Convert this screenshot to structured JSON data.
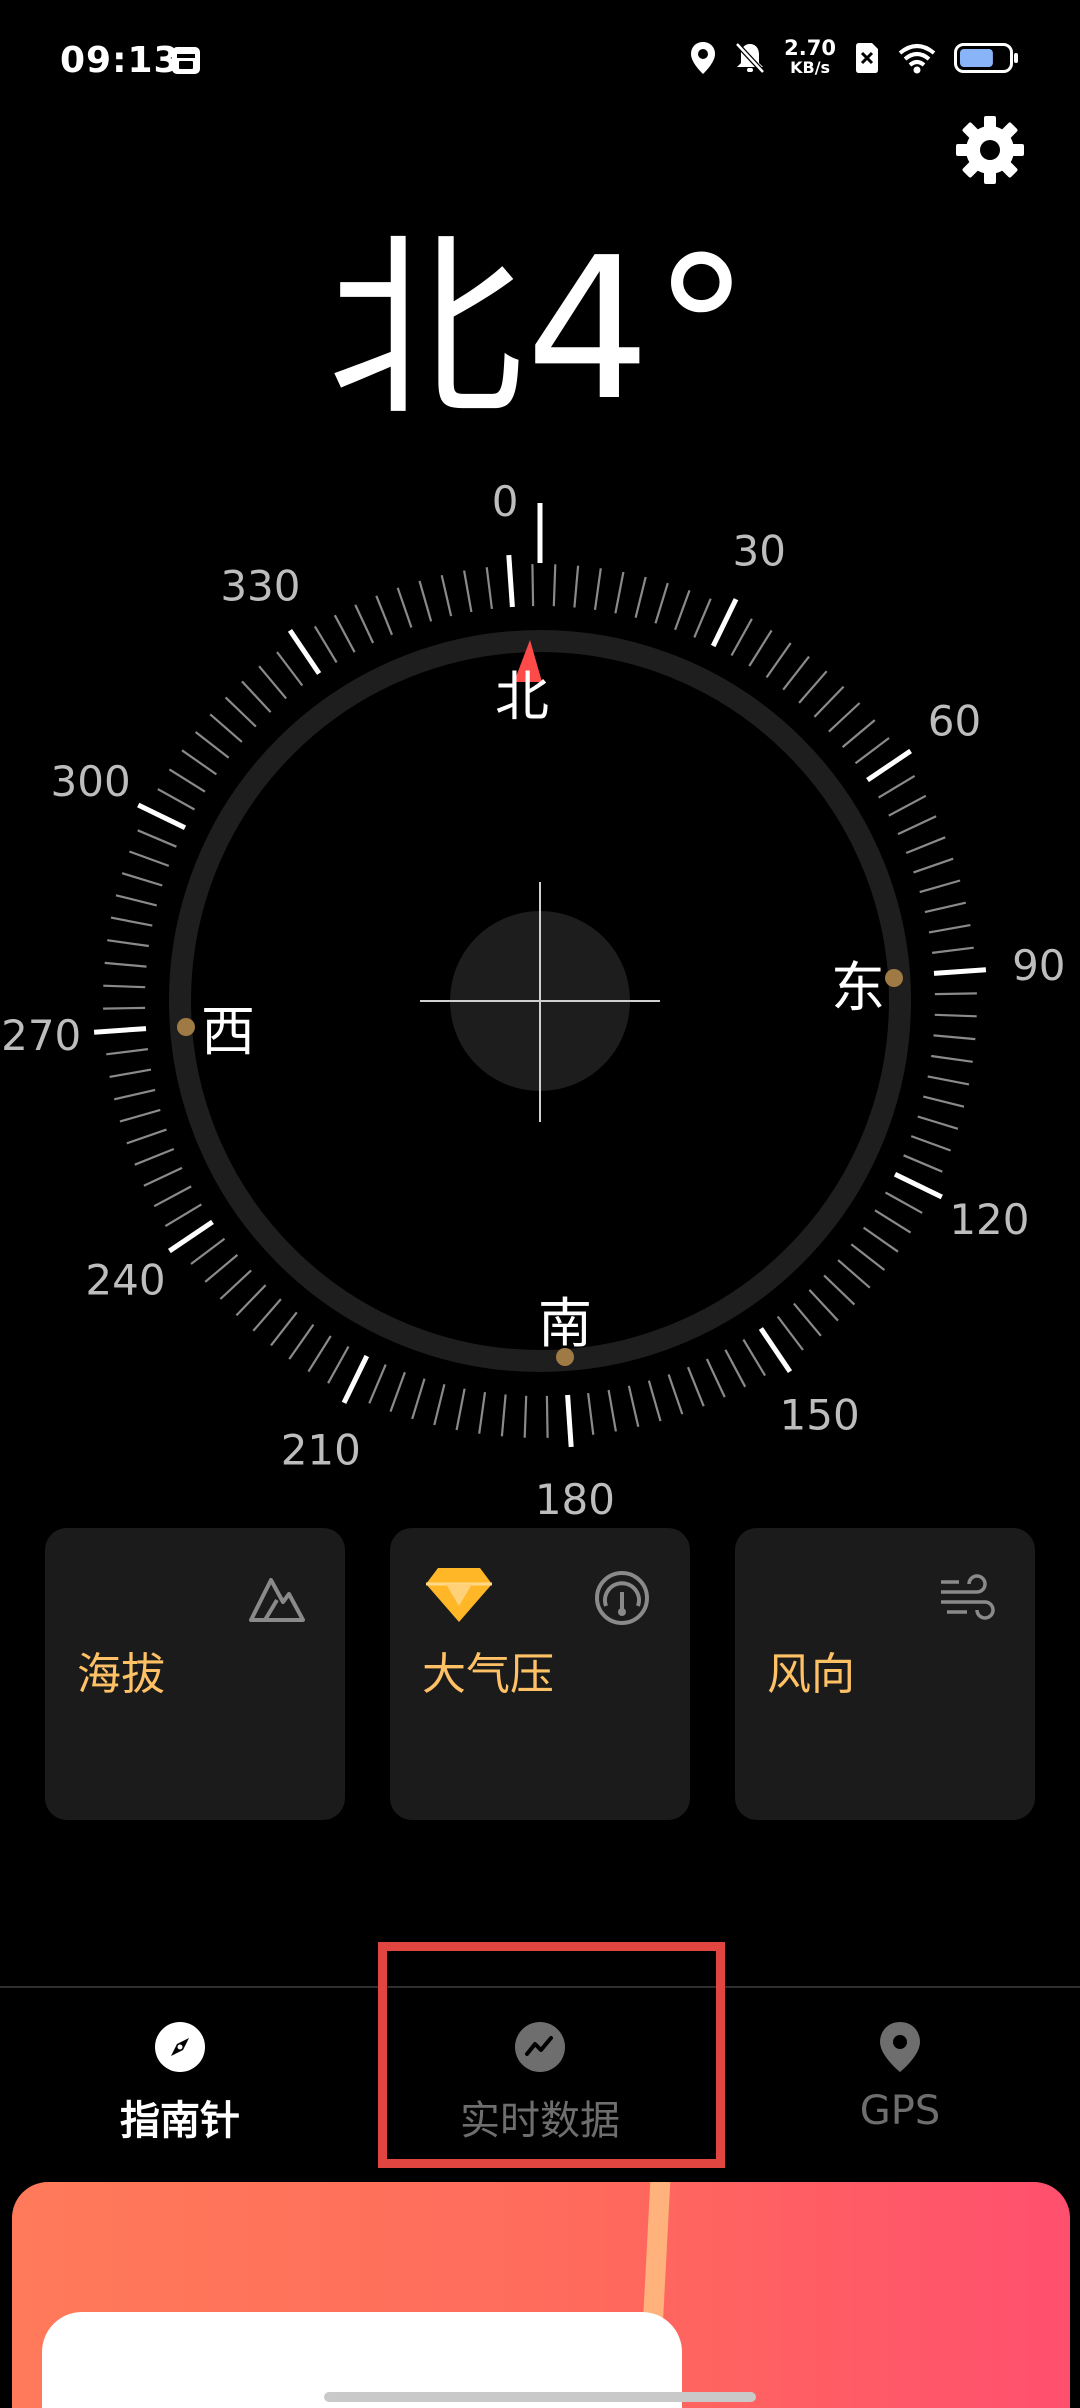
{
  "status_bar": {
    "time": "09:13",
    "net_speed_value": "2.70",
    "net_speed_unit": "KB/s",
    "battery_level": 0.7
  },
  "compass": {
    "direction": "北",
    "degrees": "4°",
    "heading_value": 4,
    "cardinals": {
      "north": "北",
      "east": "东",
      "south": "南",
      "west": "西"
    },
    "scale_labels": [
      "0",
      "30",
      "60",
      "90",
      "120",
      "150",
      "180",
      "210",
      "240",
      "270",
      "300",
      "330"
    ],
    "needle_color": "#ff4a4a",
    "marker_color": "#a07a45"
  },
  "cards": [
    {
      "title": "海拔",
      "icon": "mountain-icon"
    },
    {
      "title": "大气压",
      "icon": "gauge-icon",
      "badge": "diamond-icon"
    },
    {
      "title": "风向",
      "icon": "wind-icon"
    }
  ],
  "nav": {
    "items": [
      {
        "label": "指南针",
        "icon": "compass-icon",
        "active": true
      },
      {
        "label": "实时数据",
        "icon": "realtime-chart-icon",
        "active": false
      },
      {
        "label": "GPS",
        "icon": "location-pin-icon",
        "active": false
      }
    ]
  },
  "colors": {
    "accent": "#ffc165",
    "highlight": "#e0453f",
    "ad_gradient_start": "#ff7a5a",
    "ad_gradient_end": "#ff4f6e"
  }
}
